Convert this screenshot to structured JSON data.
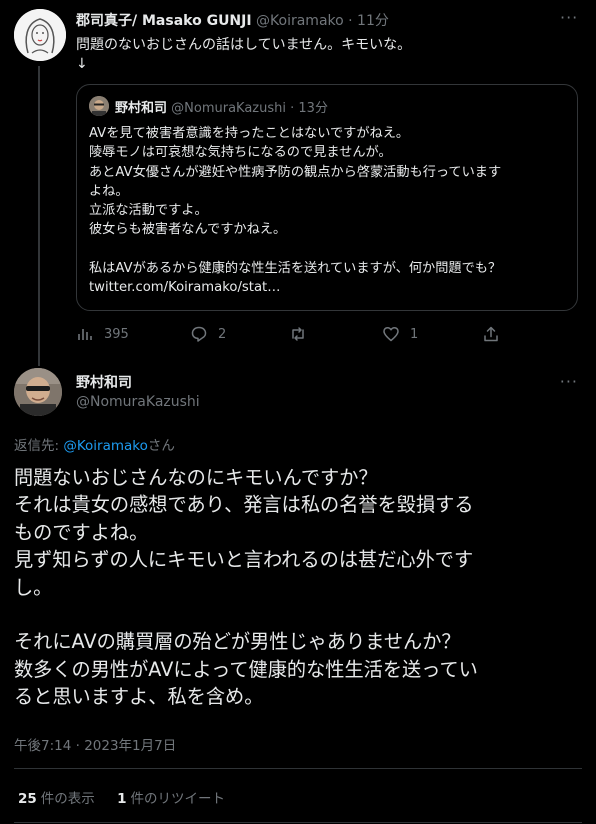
{
  "original_tweet": {
    "author_name": "郡司真子/ Masako GUNJI",
    "handle": "@Koiramako",
    "time": "· 11分",
    "text": "問題のないおじさんの話はしていません。キモいな。\n↓",
    "more_icon": "more-horizontal-icon"
  },
  "quoted_tweet": {
    "author_name": "野村和司",
    "handle": "@NomuraKazushi",
    "time": "· 13分",
    "text": "AVを見て被害者意識を持ったことはないですがねえ。\n陵辱モノは可哀想な気持ちになるので見ませんが。\nあとAV女優さんが避妊や性病予防の観点から啓蒙活動も行っています\nよね。\n立派な活動ですよ。\n彼女らも被害者なんですかねえ。\n\n私はAVがあるから健康的な性生活を送れていますが、何か問題でも？\ntwitter.com/Koiramako/stat…"
  },
  "actions": {
    "views": "395",
    "replies": "2",
    "retweets": "",
    "likes": "1"
  },
  "main_tweet": {
    "author_name": "野村和司",
    "handle": "@NomuraKazushi",
    "reply_prefix": "返信先: ",
    "reply_handle": "@Koiramako",
    "reply_suffix": "さん",
    "text": "問題ないおじさんなのにキモいんですか？\nそれは貴女の感想であり、発言は私の名誉を毀損する\nものですよね。\n見ず知らずの人にキモいと言われるのは甚だ心外です\nし。\n\nそれにAVの購買層の殆どが男性じゃありませんか？\n数多くの男性がAVによって健康的な性生活を送ってい\nると思いますよ、私を含め。",
    "timestamp": "午後7:14 · 2023年1月7日"
  },
  "stats": {
    "views_count": "25",
    "views_label": "件の表示",
    "retweets_count": "1",
    "retweets_label": "件のリツイート"
  },
  "colors": {
    "background": "#000000",
    "text": "#e7e9ea",
    "muted": "#71767b",
    "link": "#1d9bf0",
    "border": "#333639"
  }
}
